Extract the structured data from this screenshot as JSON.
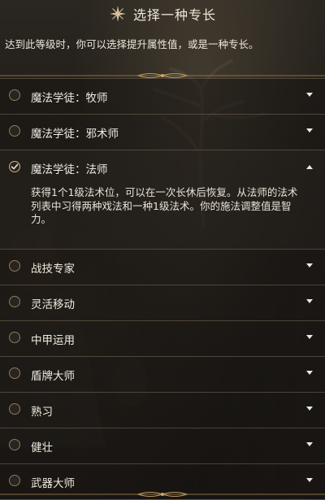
{
  "header": {
    "title": "选择一种专长",
    "icon": "sparkle-star-icon"
  },
  "subtitle": "达到此等级时，你可以选择提升属性值，或是一种专长。",
  "feats": [
    {
      "label": "魔法学徒：牧师",
      "selected": false,
      "expanded": false
    },
    {
      "label": "魔法学徒：邪术师",
      "selected": false,
      "expanded": false
    },
    {
      "label": "魔法学徒：法师",
      "selected": true,
      "expanded": true,
      "description": "获得1个1级法术位，可以在一次长休后恢复。从法师的法术列表中习得两种戏法和一种1级法术。你的施法调整值是智力。"
    },
    {
      "label": "战技专家",
      "selected": false,
      "expanded": false
    },
    {
      "label": "灵活移动",
      "selected": false,
      "expanded": false
    },
    {
      "label": "中甲运用",
      "selected": false,
      "expanded": false
    },
    {
      "label": "盾牌大师",
      "selected": false,
      "expanded": false
    },
    {
      "label": "熟习",
      "selected": false,
      "expanded": false
    },
    {
      "label": "健壮",
      "selected": false,
      "expanded": false
    },
    {
      "label": "武器大师",
      "selected": false,
      "expanded": false
    }
  ],
  "colors": {
    "accent_gold": "#c9a96a",
    "text": "#f0eadf",
    "divider": "#786955"
  }
}
